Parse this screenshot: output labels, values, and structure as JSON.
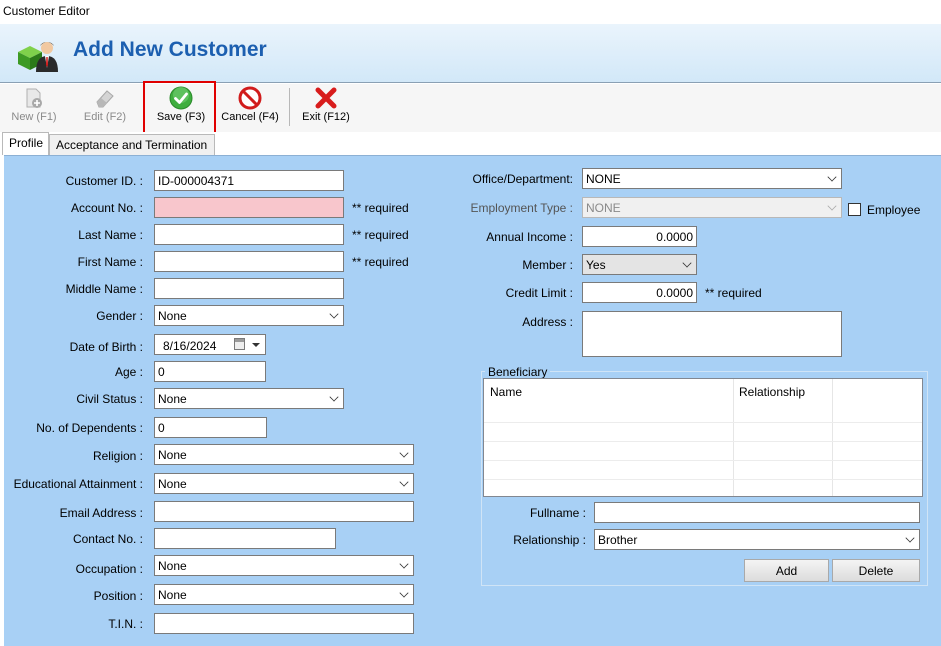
{
  "window": {
    "title": "Customer Editor"
  },
  "header": {
    "title": "Add New Customer",
    "icon": "customer-cube-icon"
  },
  "toolbar": {
    "new_label": "New (F1)",
    "edit_label": "Edit (F2)",
    "save_label": "Save (F3)",
    "cancel_label": "Cancel (F4)",
    "exit_label": "Exit (F12)"
  },
  "tabs": [
    {
      "label": "Profile",
      "active": true
    },
    {
      "label": "Acceptance and Termination",
      "active": false
    }
  ],
  "left": {
    "customer_id": {
      "label": "Customer ID. :",
      "value": "ID-000004371"
    },
    "account_no": {
      "label": "Account No. :",
      "value": "",
      "note": "** required"
    },
    "last_name": {
      "label": "Last Name :",
      "value": "",
      "note": "** required"
    },
    "first_name": {
      "label": "First Name :",
      "value": "",
      "note": "** required"
    },
    "middle_name": {
      "label": "Middle Name :",
      "value": ""
    },
    "gender": {
      "label": "Gender :",
      "value": "None"
    },
    "dob": {
      "label": "Date of Birth :",
      "value": "8/16/2024"
    },
    "age": {
      "label": "Age :",
      "value": "0"
    },
    "civil_status": {
      "label": "Civil Status :",
      "value": "None"
    },
    "dependents": {
      "label": "No. of Dependents :",
      "value": "0"
    },
    "religion": {
      "label": "Religion :",
      "value": "None"
    },
    "education": {
      "label": "Educational Attainment :",
      "value": "None"
    },
    "email": {
      "label": "Email Address :",
      "value": ""
    },
    "contact": {
      "label": "Contact No. :",
      "value": ""
    },
    "occupation": {
      "label": "Occupation :",
      "value": "None"
    },
    "position": {
      "label": "Position :",
      "value": "None"
    },
    "tin": {
      "label": "T.I.N. :",
      "value": ""
    }
  },
  "right": {
    "office": {
      "label": "Office/Department:",
      "value": "NONE"
    },
    "employment_type": {
      "label": "Employment Type :",
      "value": "NONE"
    },
    "employee": {
      "label": "Employee",
      "checked": false
    },
    "annual_income": {
      "label": "Annual Income :",
      "value": "0.0000"
    },
    "member": {
      "label": "Member :",
      "value": "Yes"
    },
    "credit_limit": {
      "label": "Credit Limit :",
      "value": "0.0000",
      "note": "** required"
    },
    "address": {
      "label": "Address :",
      "value": ""
    }
  },
  "beneficiary": {
    "title": "Beneficiary",
    "columns": [
      "Name",
      "Relationship"
    ],
    "fullname": {
      "label": "Fullname :",
      "value": ""
    },
    "relationship": {
      "label": "Relationship :",
      "value": "Brother"
    },
    "add_label": "Add",
    "delete_label": "Delete"
  },
  "colors": {
    "panel_bg": "#a8d0f5",
    "header_text": "#1c5fb0",
    "required_bg": "#f8c6cc",
    "highlight": "#e00000"
  }
}
